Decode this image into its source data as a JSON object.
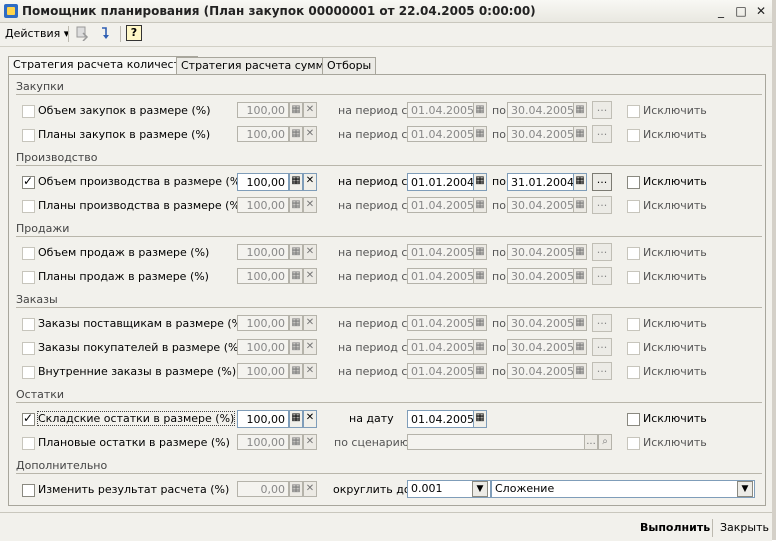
{
  "window": {
    "title": "Помощник планирования (План закупок 00000001 от 22.04.2005 0:00:00)"
  },
  "toolbar": {
    "actions_label": "Действия ▾",
    "help_label": "?"
  },
  "tabs": [
    {
      "label": "Стратегия расчета количества",
      "active": true
    },
    {
      "label": "Стратегия расчета суммы",
      "active": false
    },
    {
      "label": "Отборы",
      "active": false
    }
  ],
  "sections": {
    "purchases": "Закупки",
    "production": "Производство",
    "sales": "Продажи",
    "orders": "Заказы",
    "stock": "Остатки",
    "additional": "Дополнительно"
  },
  "common": {
    "period_from": "на период с",
    "period_to": "по",
    "exclude": "Исключить",
    "dots": "..."
  },
  "rows": [
    {
      "label": "Объем закупок в размере (%)",
      "value": "100,00",
      "from": "01.04.2005",
      "to": "30.04.2005",
      "enabled": false,
      "checked": false,
      "exclude_checked": false
    },
    {
      "label": "Планы закупок в размере (%)",
      "value": "100,00",
      "from": "01.04.2005",
      "to": "30.04.2005",
      "enabled": false,
      "checked": false,
      "exclude_checked": false
    },
    {
      "label": "Объем производства в размере (%)",
      "value": "100,00",
      "from": "01.01.2004",
      "to": "31.01.2004",
      "enabled": true,
      "checked": true,
      "exclude_checked": false
    },
    {
      "label": "Планы производства в размере (%)",
      "value": "100,00",
      "from": "01.04.2005",
      "to": "30.04.2005",
      "enabled": false,
      "checked": false,
      "exclude_checked": false
    },
    {
      "label": "Объем продаж в размере (%)",
      "value": "100,00",
      "from": "01.04.2005",
      "to": "30.04.2005",
      "enabled": false,
      "checked": false,
      "exclude_checked": false
    },
    {
      "label": "Планы продаж в размере (%)",
      "value": "100,00",
      "from": "01.04.2005",
      "to": "30.04.2005",
      "enabled": false,
      "checked": false,
      "exclude_checked": false
    },
    {
      "label": "Заказы поставщикам в размере (%)",
      "value": "100,00",
      "from": "01.04.2005",
      "to": "30.04.2005",
      "enabled": false,
      "checked": false,
      "exclude_checked": false
    },
    {
      "label": "Заказы покупателей в размере (%)",
      "value": "100,00",
      "from": "01.04.2005",
      "to": "30.04.2005",
      "enabled": false,
      "checked": false,
      "exclude_checked": false
    },
    {
      "label": "Внутренние заказы в размере (%)",
      "value": "100,00",
      "from": "01.04.2005",
      "to": "30.04.2005",
      "enabled": false,
      "checked": false,
      "exclude_checked": false
    }
  ],
  "stock": {
    "warehouse": {
      "label": "Складские остатки в размере (%)",
      "value": "100,00",
      "on_date_label": "на дату",
      "date": "01.04.2005",
      "checked": true,
      "exclude_checked": false
    },
    "planned": {
      "label": "Плановые остатки в размере (%)",
      "value": "100,00",
      "scenario_label": "по сценарию",
      "scenario": "",
      "checked": false,
      "exclude_checked": false
    }
  },
  "additional": {
    "change_label": "Изменить результат расчета (%)",
    "value": "0,00",
    "round_label": "округлить до:",
    "round_value": "0.001",
    "operation_value": "Сложение",
    "checked": false
  },
  "bottom": {
    "run_label": "Выполнить",
    "close_label": "Закрыть"
  }
}
